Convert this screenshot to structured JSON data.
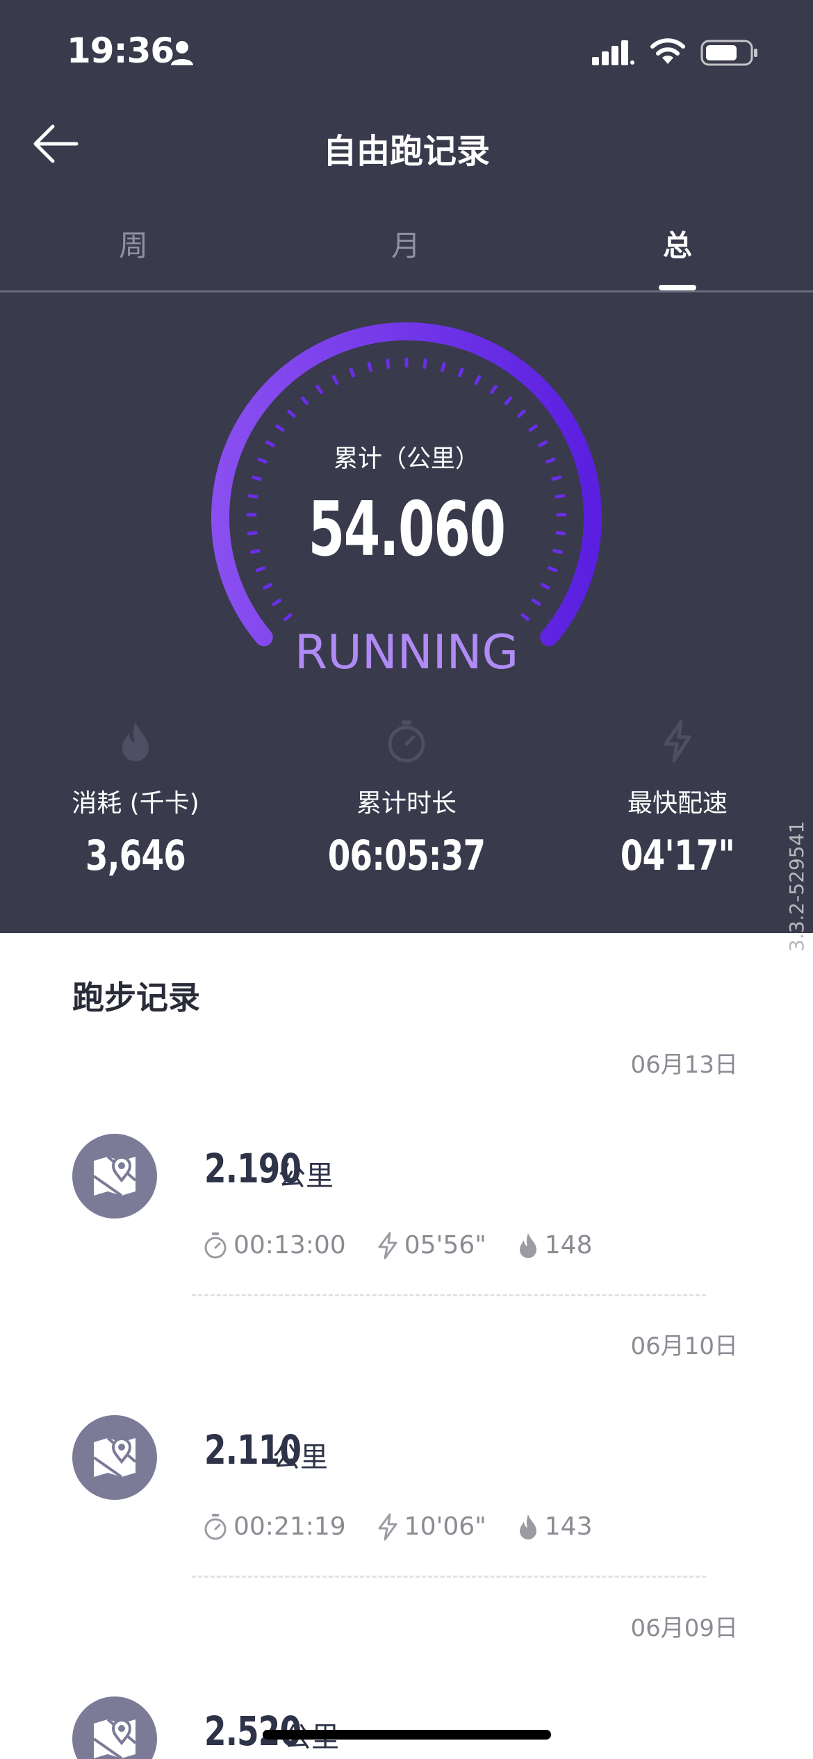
{
  "status_bar": {
    "time": "19:36"
  },
  "nav": {
    "title": "自由跑记录"
  },
  "tabs": [
    {
      "label": "周",
      "active": false
    },
    {
      "label": "月",
      "active": false
    },
    {
      "label": "总",
      "active": true
    }
  ],
  "summary": {
    "label": "累计（公里）",
    "value": "54.060",
    "badge": "RUNNING",
    "accent_color": "#6a2ee8"
  },
  "stats": [
    {
      "icon": "flame-icon",
      "label": "消耗 (千卡)",
      "value": "3,646"
    },
    {
      "icon": "stopwatch-icon",
      "label": "累计时长",
      "value": "06:05:37"
    },
    {
      "icon": "lightning-icon",
      "label": "最快配速",
      "value": "04'17\""
    }
  ],
  "version": "3.3.2-529541",
  "records": {
    "title": "跑步记录",
    "items": [
      {
        "date": "06月13日",
        "distance": "2.190",
        "unit": "公里",
        "duration": "00:13:00",
        "pace": "05'56\"",
        "calories": "148"
      },
      {
        "date": "06月10日",
        "distance": "2.110",
        "unit": "公里",
        "duration": "00:21:19",
        "pace": "10'06\"",
        "calories": "143"
      },
      {
        "date": "06月09日",
        "distance": "2.520",
        "unit": "公里"
      }
    ]
  }
}
